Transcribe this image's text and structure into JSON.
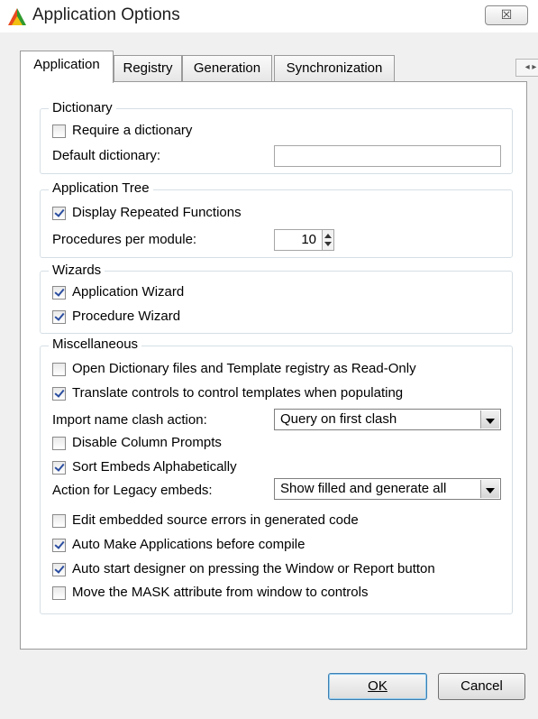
{
  "window": {
    "title": "Application Options",
    "close_glyph": "☒"
  },
  "tabs": [
    {
      "label": "Application",
      "active": true
    },
    {
      "label": "Registry",
      "active": false
    },
    {
      "label": "Generation",
      "active": false
    },
    {
      "label": "Synchronization",
      "active": false
    }
  ],
  "tab_scroll_glyph": "◂ ▸",
  "dictionary": {
    "title": "Dictionary",
    "require_label": "Require a dictionary",
    "require_checked": false,
    "default_label": "Default dictionary:",
    "default_value": ""
  },
  "app_tree": {
    "title": "Application Tree",
    "display_repeated_label": "Display Repeated Functions",
    "display_repeated_checked": true,
    "procedures_label": "Procedures per module:",
    "procedures_value": "10"
  },
  "wizards": {
    "title": "Wizards",
    "app_wizard_label": "Application Wizard",
    "app_wizard_checked": true,
    "proc_wizard_label": "Procedure Wizard",
    "proc_wizard_checked": true
  },
  "misc": {
    "title": "Miscellaneous",
    "open_readonly_label": "Open Dictionary files and Template registry as Read-Only",
    "open_readonly_checked": false,
    "translate_label": "Translate controls to control templates when populating",
    "translate_checked": true,
    "import_clash_label": "Import name clash action:",
    "import_clash_value": "Query on first clash",
    "disable_prompts_label": "Disable Column Prompts",
    "disable_prompts_checked": false,
    "sort_embeds_label": "Sort Embeds Alphabetically",
    "sort_embeds_checked": true,
    "legacy_label": "Action for Legacy embeds:",
    "legacy_value": "Show filled and generate all",
    "edit_errors_label": "Edit embedded source errors in generated code",
    "edit_errors_checked": false,
    "auto_make_label": "Auto Make Applications before compile",
    "auto_make_checked": true,
    "auto_designer_label": "Auto start designer on pressing the Window or Report button",
    "auto_designer_checked": true,
    "move_mask_label": "Move the MASK attribute from window to controls",
    "move_mask_checked": false
  },
  "buttons": {
    "ok": "OK",
    "cancel": "Cancel"
  },
  "colors": {
    "accent": "#3c7fb1",
    "checkmark": "#2a4da0"
  }
}
